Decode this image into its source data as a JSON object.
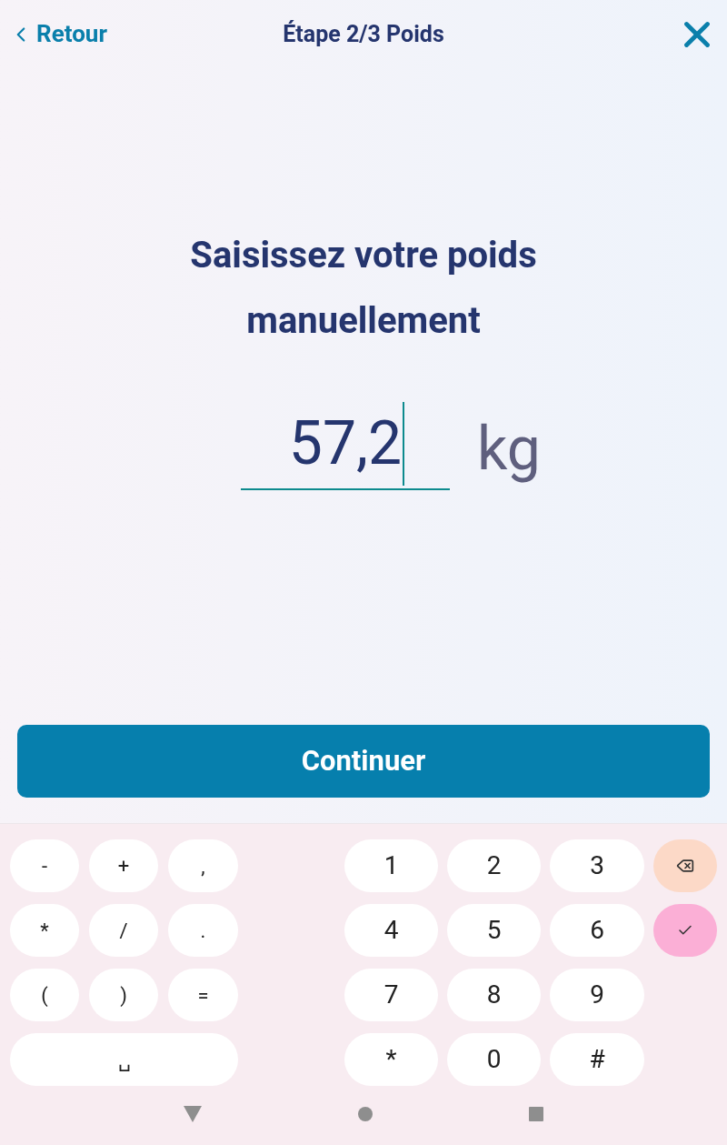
{
  "header": {
    "back_label": "Retour",
    "title": "Étape 2/3 Poids"
  },
  "heading": "Saisissez votre poids manuellement",
  "weight_field": {
    "value": "57,2",
    "unit": "kg",
    "focused": true
  },
  "continue_button": "Continuer",
  "keyboard": {
    "symbol_keys": [
      {
        "kind": "key",
        "label": "-"
      },
      {
        "kind": "key",
        "label": "+"
      },
      {
        "kind": "key",
        "label": ","
      },
      {
        "kind": "key",
        "label": "*"
      },
      {
        "kind": "key",
        "label": "/"
      },
      {
        "kind": "key",
        "label": "."
      },
      {
        "kind": "key",
        "label": "("
      },
      {
        "kind": "key",
        "label": ")"
      },
      {
        "kind": "key",
        "label": "="
      },
      {
        "kind": "space",
        "label": "␣"
      }
    ],
    "digit_keys": [
      "1",
      "2",
      "3",
      "4",
      "5",
      "6",
      "7",
      "8",
      "9",
      "*",
      "0",
      "#"
    ],
    "action_keys": [
      {
        "kind": "backspace"
      },
      {
        "kind": "done"
      }
    ]
  }
}
